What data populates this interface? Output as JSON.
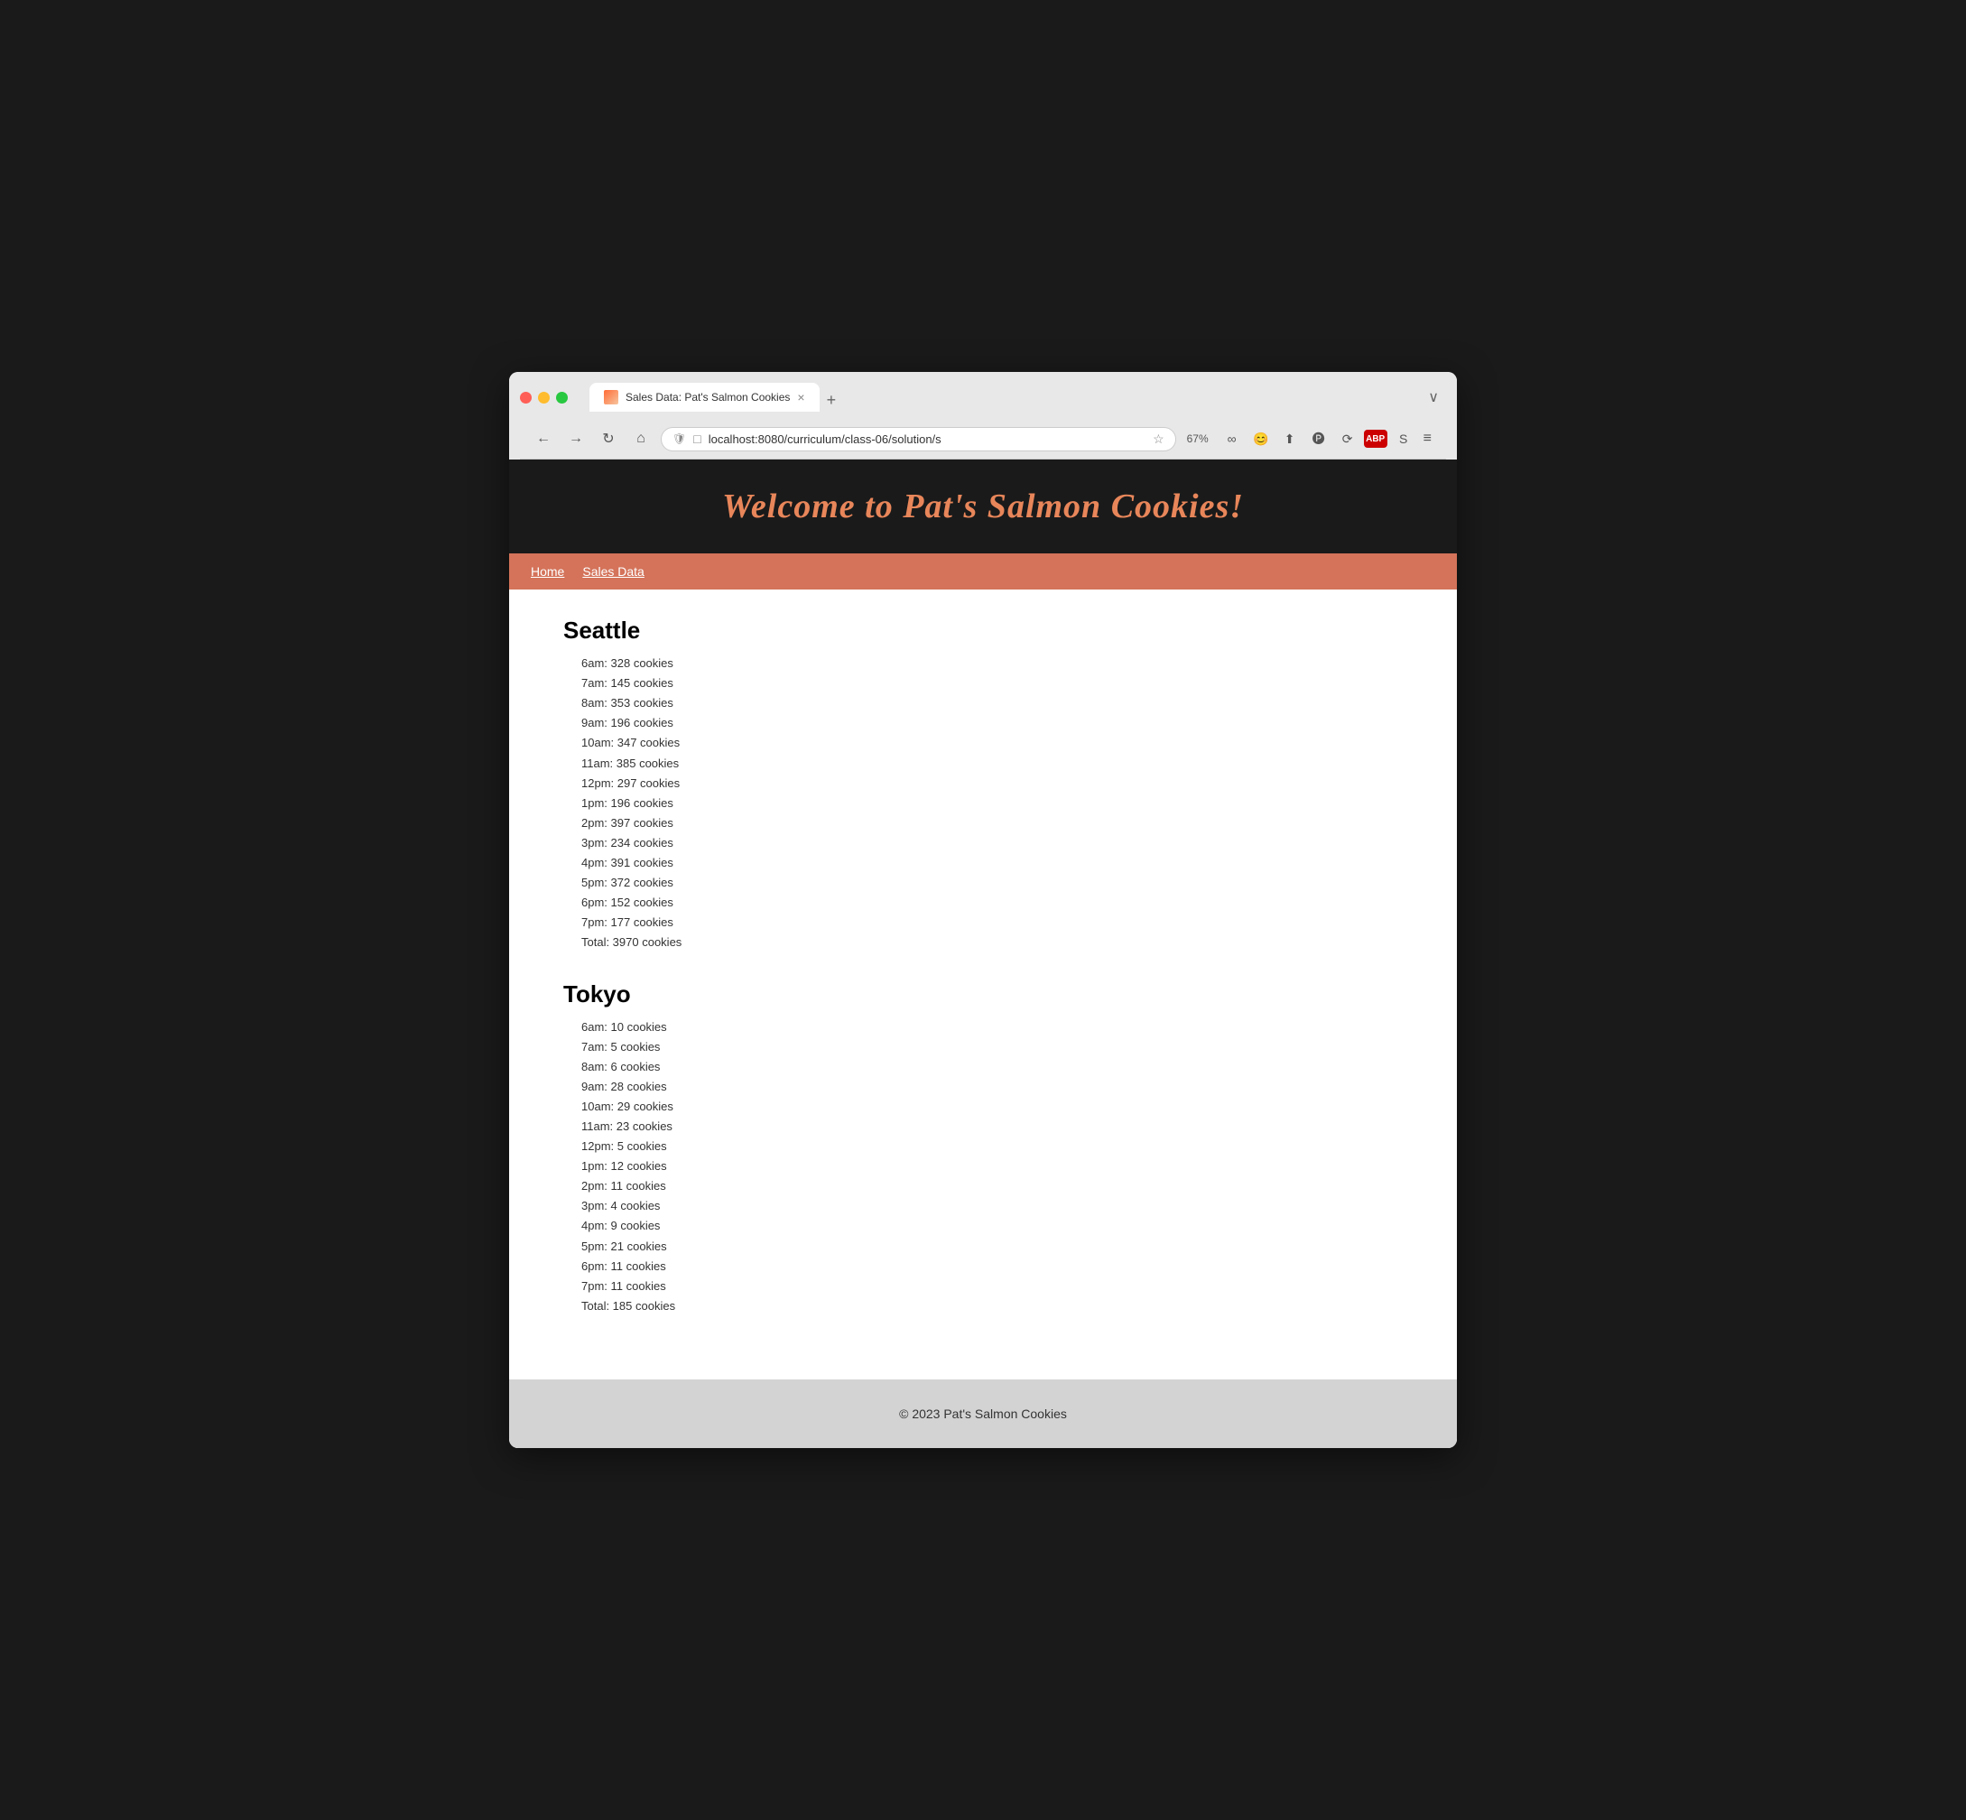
{
  "browser": {
    "tab_title": "Sales Data: Pat's Salmon Cookies",
    "url": "localhost:8080/curriculum/class-06/solution/s",
    "zoom": "67%",
    "tab_close": "×",
    "tab_new": "+",
    "tab_list": "∨",
    "back": "←",
    "forward": "→",
    "refresh": "↻",
    "home": "⌂",
    "menu": "≡"
  },
  "site": {
    "header_title": "Welcome to Pat's Salmon Cookies!",
    "nav": {
      "home_label": "Home",
      "sales_label": "Sales Data"
    },
    "footer_text": "© 2023 Pat's Salmon Cookies"
  },
  "locations": [
    {
      "name": "Seattle",
      "hours": [
        "6am: 328 cookies",
        "7am: 145 cookies",
        "8am: 353 cookies",
        "9am: 196 cookies",
        "10am: 347 cookies",
        "11am: 385 cookies",
        "12pm: 297 cookies",
        "1pm: 196 cookies",
        "2pm: 397 cookies",
        "3pm: 234 cookies",
        "4pm: 391 cookies",
        "5pm: 372 cookies",
        "6pm: 152 cookies",
        "7pm: 177 cookies"
      ],
      "total": "Total: 3970 cookies"
    },
    {
      "name": "Tokyo",
      "hours": [
        "6am: 10 cookies",
        "7am: 5 cookies",
        "8am: 6 cookies",
        "9am: 28 cookies",
        "10am: 29 cookies",
        "11am: 23 cookies",
        "12pm: 5 cookies",
        "1pm: 12 cookies",
        "2pm: 11 cookies",
        "3pm: 4 cookies",
        "4pm: 9 cookies",
        "5pm: 21 cookies",
        "6pm: 11 cookies",
        "7pm: 11 cookies"
      ],
      "total": "Total: 185 cookies"
    }
  ]
}
